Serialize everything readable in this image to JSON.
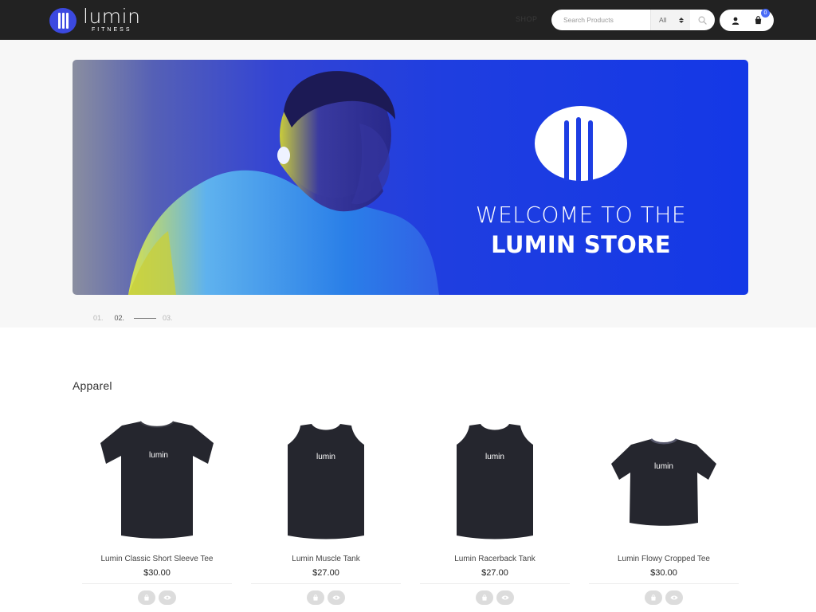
{
  "header": {
    "brand_name": "lumin",
    "brand_sub": "FITNESS",
    "nav_shop": "SHOP",
    "search": {
      "placeholder": "Search Products",
      "category": "All"
    },
    "cart_count": "0"
  },
  "hero": {
    "line1": "WELCOME TO THE",
    "line2": "LUMIN STORE",
    "slides": [
      "01.",
      "02.",
      "03."
    ],
    "active_slide": "02."
  },
  "section": {
    "title": "Apparel"
  },
  "products": [
    {
      "name": "Lumin Classic Short Sleeve Tee",
      "price": "$30.00",
      "shirt_text": "lumin"
    },
    {
      "name": "Lumin Muscle Tank",
      "price": "$27.00",
      "shirt_text": "lumin"
    },
    {
      "name": "Lumin Racerback Tank",
      "price": "$27.00",
      "shirt_text": "lumin"
    },
    {
      "name": "Lumin Flowy Cropped Tee",
      "price": "$30.00",
      "shirt_text": "lumin"
    }
  ],
  "icons": [
    "search-icon",
    "user-icon",
    "cart-icon",
    "bag-icon",
    "eye-icon"
  ],
  "colors": {
    "header_bg": "#222222",
    "brand_blue": "#3b49e0",
    "hero_blue": "#1438e6",
    "badge": "#4a6cf7"
  }
}
